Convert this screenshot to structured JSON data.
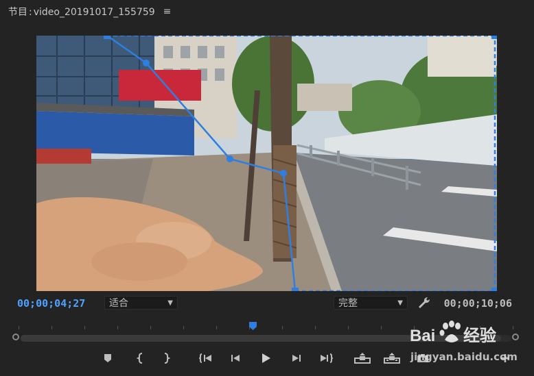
{
  "panel": {
    "title_prefix": "节目",
    "sequence_name": "video_20191017_155759",
    "menu_icon": "hamburger-menu-icon"
  },
  "viewer": {
    "frame_description_icon": "video-frame"
  },
  "controls": {
    "current_timecode": "00;00;04;27",
    "duration_timecode": "00;00;10;06",
    "zoom_select": "适合",
    "quality_select": "完整",
    "settings_icon": "wrench-icon"
  },
  "transport": {
    "buttons": [
      {
        "name": "add-marker-button",
        "icon": "marker-icon"
      },
      {
        "name": "mark-in-button",
        "icon": "mark-in-icon"
      },
      {
        "name": "mark-out-button",
        "icon": "mark-out-icon"
      },
      {
        "name": "go-to-in-button",
        "icon": "go-to-in-icon"
      },
      {
        "name": "step-back-button",
        "icon": "step-back-icon"
      },
      {
        "name": "play-button",
        "icon": "play-icon"
      },
      {
        "name": "step-forward-button",
        "icon": "step-forward-icon"
      },
      {
        "name": "go-to-out-button",
        "icon": "go-to-out-icon"
      },
      {
        "name": "lift-button",
        "icon": "lift-icon"
      },
      {
        "name": "extract-button",
        "icon": "extract-icon"
      },
      {
        "name": "export-frame-button",
        "icon": "camera-icon"
      },
      {
        "name": "add-button",
        "icon": "plus-icon"
      }
    ]
  },
  "watermark": {
    "brand": "Bai经验",
    "url": "jingyan.baidu.com"
  }
}
